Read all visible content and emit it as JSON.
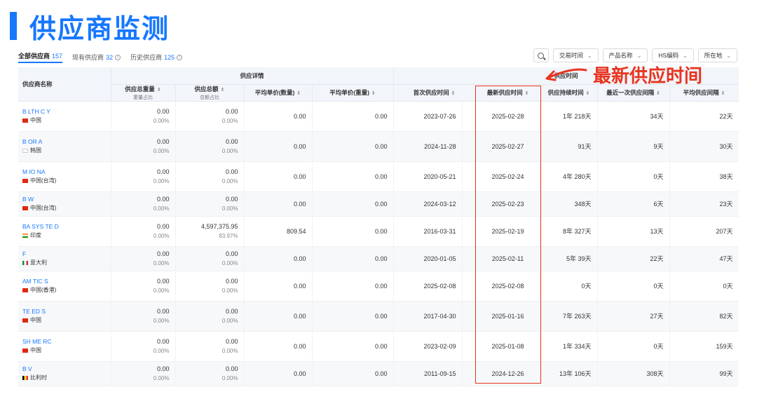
{
  "page": {
    "title": "供应商监测"
  },
  "annotation": {
    "label": "最新供应时间"
  },
  "tabs": [
    {
      "label": "全部供应商",
      "count": "157",
      "active": true
    },
    {
      "label": "现有供应商",
      "count": "32",
      "active": false
    },
    {
      "label": "历史供应商",
      "count": "125",
      "active": false
    }
  ],
  "filters": [
    {
      "label": "交易时间"
    },
    {
      "label": "产品名称"
    },
    {
      "label": "HS编码"
    },
    {
      "label": "所在地"
    }
  ],
  "table": {
    "group_headers": {
      "supplier_name": "供应商名称",
      "supply_details": "供应详情",
      "supply_time": "供应时间"
    },
    "columns": [
      {
        "label": "供应总重量",
        "sub": "重量占比"
      },
      {
        "label": "供应总额",
        "sub": "总额占比"
      },
      {
        "label": "平均单价(数量)",
        "sub": ""
      },
      {
        "label": "平均单价(重量)",
        "sub": ""
      },
      {
        "label": "首次供应时间",
        "sub": ""
      },
      {
        "label": "最新供应时间",
        "sub": ""
      },
      {
        "label": "供应持续时间",
        "sub": ""
      },
      {
        "label": "最近一次供应间隔",
        "sub": ""
      },
      {
        "label": "平均供应间隔",
        "sub": ""
      }
    ],
    "rows": [
      {
        "name": "B LTH C Y",
        "country": "中国",
        "flag": "cn",
        "weight": "0.00",
        "weight_pct": "0.00%",
        "amount": "0.00",
        "amount_pct": "0.00%",
        "unit_qty": "0.00",
        "unit_weight": "0.00",
        "first": "2023-07-26",
        "latest": "2025-02-28",
        "duration": "1年 218天",
        "last_gap": "34天",
        "avg_gap": "22天"
      },
      {
        "name": "B OR A",
        "country": "韩国",
        "flag": "kr",
        "weight": "0.00",
        "weight_pct": "0.00%",
        "amount": "0.00",
        "amount_pct": "0.00%",
        "unit_qty": "0.00",
        "unit_weight": "0.00",
        "first": "2024-11-28",
        "latest": "2025-02-27",
        "duration": "91天",
        "last_gap": "9天",
        "avg_gap": "30天"
      },
      {
        "name": "M IO NA",
        "country": "中国(台湾)",
        "flag": "tw",
        "weight": "0.00",
        "weight_pct": "0.00%",
        "amount": "0.00",
        "amount_pct": "0.00%",
        "unit_qty": "0.00",
        "unit_weight": "0.00",
        "first": "2020-05-21",
        "latest": "2025-02-24",
        "duration": "4年 280天",
        "last_gap": "0天",
        "avg_gap": "38天"
      },
      {
        "name": "B W",
        "country": "中国(台湾)",
        "flag": "tw",
        "weight": "0.00",
        "weight_pct": "0.00%",
        "amount": "0.00",
        "amount_pct": "0.00%",
        "unit_qty": "0.00",
        "unit_weight": "0.00",
        "first": "2024-03-12",
        "latest": "2025-02-23",
        "duration": "348天",
        "last_gap": "6天",
        "avg_gap": "23天"
      },
      {
        "name": "BA SYS TE D",
        "country": "印度",
        "flag": "in",
        "weight": "0.00",
        "weight_pct": "0.00%",
        "amount": "4,597,375.95",
        "amount_pct": "83.97%",
        "unit_qty": "809.54",
        "unit_weight": "0.00",
        "first": "2016-03-31",
        "latest": "2025-02-19",
        "duration": "8年 327天",
        "last_gap": "13天",
        "avg_gap": "207天"
      },
      {
        "name": "F",
        "country": "意大利",
        "flag": "it",
        "weight": "0.00",
        "weight_pct": "0.00%",
        "amount": "0.00",
        "amount_pct": "0.00%",
        "unit_qty": "0.00",
        "unit_weight": "0.00",
        "first": "2020-01-05",
        "latest": "2025-02-11",
        "duration": "5年 39天",
        "last_gap": "22天",
        "avg_gap": "47天"
      },
      {
        "name": "AM TIC S",
        "country": "中国(香港)",
        "flag": "hk",
        "weight": "0.00",
        "weight_pct": "0.00%",
        "amount": "0.00",
        "amount_pct": "0.00%",
        "unit_qty": "0.00",
        "unit_weight": "0.00",
        "first": "2025-02-08",
        "latest": "2025-02-08",
        "duration": "0天",
        "last_gap": "0天",
        "avg_gap": "0天"
      },
      {
        "name": "TE ED S",
        "country": "中国",
        "flag": "cn",
        "weight": "0.00",
        "weight_pct": "0.00%",
        "amount": "0.00",
        "amount_pct": "0.00%",
        "unit_qty": "0.00",
        "unit_weight": "0.00",
        "first": "2017-04-30",
        "latest": "2025-01-16",
        "duration": "7年 263天",
        "last_gap": "27天",
        "avg_gap": "82天"
      },
      {
        "name": "SH ME RC",
        "country": "中国",
        "flag": "cn",
        "weight": "0.00",
        "weight_pct": "0.00%",
        "amount": "0.00",
        "amount_pct": "0.00%",
        "unit_qty": "0.00",
        "unit_weight": "0.00",
        "first": "2023-02-09",
        "latest": "2025-01-08",
        "duration": "1年 334天",
        "last_gap": "0天",
        "avg_gap": "159天"
      },
      {
        "name": "B V",
        "country": "比利时",
        "flag": "be",
        "weight": "0.00",
        "weight_pct": "0.00%",
        "amount": "0.00",
        "amount_pct": "0.00%",
        "unit_qty": "0.00",
        "unit_weight": "0.00",
        "first": "2011-09-15",
        "latest": "2024-12-26",
        "duration": "13年 106天",
        "last_gap": "308天",
        "avg_gap": "99天"
      }
    ]
  },
  "colors": {
    "brand": "#1677ff",
    "annotation": "#e8341f"
  }
}
